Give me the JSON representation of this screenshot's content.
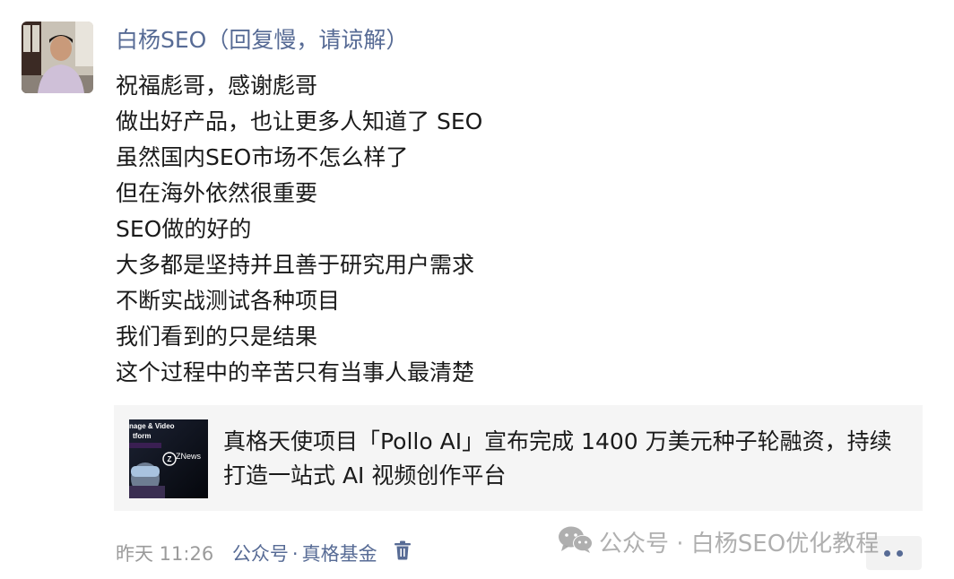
{
  "post": {
    "author": "白杨SEO（回复慢，请谅解）",
    "lines": [
      "祝福彪哥，感谢彪哥",
      "做出好产品，也让更多人知道了 SEO",
      "虽然国内SEO市场不怎么样了",
      "但在海外依然很重要",
      "SEO做的好的",
      "大多都是坚持并且善于研究用户需求",
      "不断实战测试各种项目",
      "我们看到的只是结果",
      "这个过程中的辛苦只有当事人最清楚"
    ]
  },
  "link_card": {
    "title": "真格天使项目「Pollo AI」宣布完成 1400 万美元种子轮融资，持续打造一站式 AI 视频创作平台",
    "thumb_line1": "nage & Video",
    "thumb_line2": "tform",
    "thumb_brand": "ZNews"
  },
  "meta": {
    "time": "昨天 11:26",
    "source_prefix": "公众号",
    "separator": "·",
    "source_name": "真格基金",
    "delete_icon": "trash-icon",
    "more_icon": "ellipsis-icon"
  },
  "watermark": {
    "icon": "wechat-icon",
    "text": "公众号 · 白杨SEO优化教程"
  },
  "colors": {
    "link_blue": "#576b95",
    "card_bg": "#f5f5f5",
    "meta_gray": "#9b9b9b"
  }
}
